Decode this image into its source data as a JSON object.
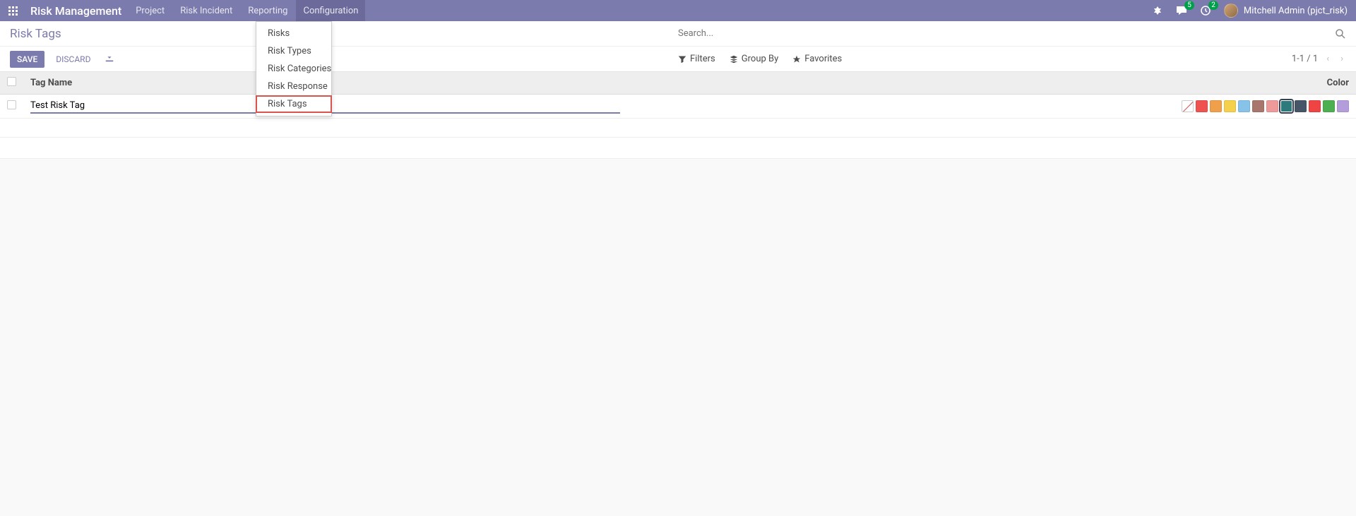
{
  "navbar": {
    "brand": "Risk Management",
    "items": [
      "Project",
      "Risk Incident",
      "Reporting",
      "Configuration"
    ],
    "messages_badge": "5",
    "activities_badge": "2",
    "user": "Mitchell Admin (pjct_risk)"
  },
  "dropdown": {
    "items": [
      "Risks",
      "Risk Types",
      "Risk Categories",
      "Risk Response",
      "Risk Tags"
    ],
    "highlighted_index": 4
  },
  "breadcrumb": "Risk Tags",
  "search": {
    "placeholder": "Search..."
  },
  "buttons": {
    "save": "SAVE",
    "discard": "DISCARD"
  },
  "filters": {
    "filters": "Filters",
    "group_by": "Group By",
    "favorites": "Favorites"
  },
  "pager": {
    "range": "1-1 / 1"
  },
  "table": {
    "headers": {
      "name": "Tag Name",
      "color": "Color"
    },
    "rows": [
      {
        "name": "Test Risk Tag",
        "selected_color_index": 7
      }
    ]
  },
  "colors": [
    "none",
    "#ef5350",
    "#f0a04b",
    "#f5d04b",
    "#87c3e8",
    "#a8766d",
    "#ef9a9a",
    "#2c7a7b",
    "#475569",
    "#ef4444",
    "#4caf50",
    "#b39ddb"
  ]
}
